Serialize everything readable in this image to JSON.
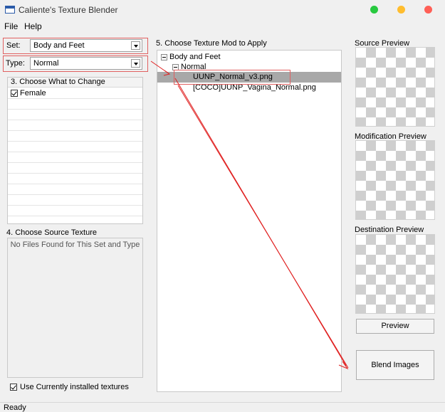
{
  "window": {
    "title": "Caliente's Texture Blender",
    "controls": [
      {
        "name": "minimize",
        "color": "#27c93f"
      },
      {
        "name": "maximize",
        "color": "#ffbd2e"
      },
      {
        "name": "close",
        "color": "#ff5f56"
      }
    ]
  },
  "menu": {
    "file": "File",
    "help": "Help"
  },
  "set": {
    "label": "Set:",
    "value": "Body and Feet"
  },
  "type": {
    "label": "Type:",
    "value": "Normal"
  },
  "change": {
    "title": "3. Choose What to Change",
    "items": [
      {
        "label": "Female",
        "checked": true
      }
    ]
  },
  "source": {
    "title": "4. Choose Source Texture",
    "empty_message": "No Files Found for This Set and Type",
    "use_installed_label": "Use Currently installed textures",
    "use_installed_checked": true
  },
  "texture_mod": {
    "title": "5. Choose Texture Mod to Apply",
    "root": "Body and Feet",
    "child": "Normal",
    "files": [
      "UUNP_Normal_v3.png",
      "[COCO]UUNP_Vagina_Normal.png"
    ],
    "selected_index": 0
  },
  "previews": {
    "source": "Source Preview",
    "modification": "Modification Preview",
    "destination": "Destination Preview"
  },
  "buttons": {
    "preview": "Preview",
    "blend": "Blend Images"
  },
  "status": "Ready",
  "colors": {
    "annotation": "#e02020",
    "selection": "#a8a8a8"
  }
}
